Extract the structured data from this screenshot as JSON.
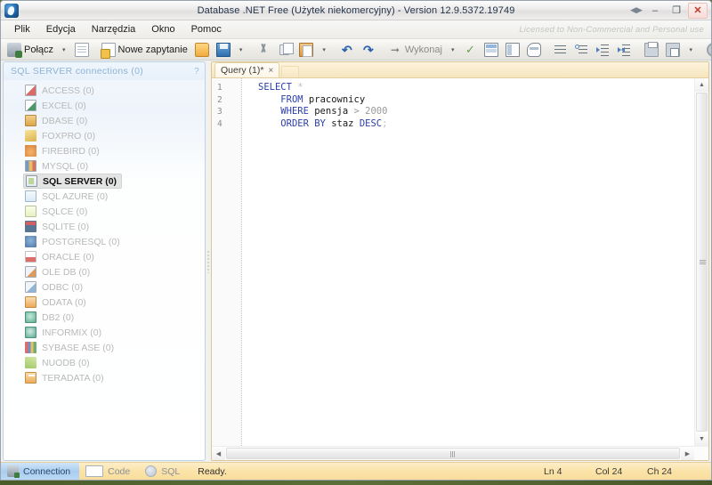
{
  "window": {
    "title": "Database .NET Free (Użytek niekomercyjny) - Version 12.9.5372.19749",
    "logo_icon": "app-logo-icon",
    "controls": {
      "restore_arrows": "◀▶",
      "minimize": "–",
      "maximize": "❐",
      "close": "✕"
    }
  },
  "menubar": {
    "items": [
      {
        "label": "Plik"
      },
      {
        "label": "Edycja"
      },
      {
        "label": "Narzędzia"
      },
      {
        "label": "Okno"
      },
      {
        "label": "Pomoc"
      }
    ],
    "license": "Licensed to Non-Commercial and Personal use"
  },
  "toolbar": {
    "connect_label": "Połącz",
    "new_query_label": "Nowe zapytanie",
    "execute_label": "Wykonaj",
    "dropdown_caret": "▾",
    "items": [
      {
        "name": "connect-button",
        "icon": "plug-icon"
      },
      {
        "name": "connect-dropdown",
        "icon": "chevron-down-icon"
      },
      {
        "name": "connection-properties-button",
        "icon": "document-icon"
      },
      {
        "name": "new-query-button",
        "icon": "new-query-icon"
      },
      {
        "name": "open-button",
        "icon": "folder-open-icon"
      },
      {
        "name": "save-button",
        "icon": "save-disk-icon"
      },
      {
        "name": "save-dropdown",
        "icon": "chevron-down-icon"
      },
      {
        "name": "cut-button",
        "icon": "scissors-icon"
      },
      {
        "name": "copy-button",
        "icon": "copy-icon"
      },
      {
        "name": "paste-button",
        "icon": "paste-icon"
      },
      {
        "name": "paste-dropdown",
        "icon": "chevron-down-icon"
      },
      {
        "name": "undo-button",
        "icon": "undo-arrow-icon"
      },
      {
        "name": "redo-button",
        "icon": "redo-arrow-icon"
      },
      {
        "name": "execute-button",
        "icon": "play-arrow-icon"
      },
      {
        "name": "execute-dropdown",
        "icon": "chevron-down-icon"
      },
      {
        "name": "verify-sql-button",
        "icon": "check-mark-icon"
      },
      {
        "name": "results-grid-button",
        "icon": "grid-icon"
      },
      {
        "name": "results-pane-button",
        "icon": "grid-columns-icon"
      },
      {
        "name": "results-message-button",
        "icon": "grid-round-icon"
      },
      {
        "name": "format-lines-button",
        "icon": "lines-icon"
      },
      {
        "name": "format-list-button",
        "icon": "bullet-lines-icon"
      },
      {
        "name": "indent-button",
        "icon": "indent-icon"
      },
      {
        "name": "outdent-button",
        "icon": "outdent-icon"
      },
      {
        "name": "print-button",
        "icon": "printer-icon"
      },
      {
        "name": "print-preview-button",
        "icon": "print-preview-icon"
      },
      {
        "name": "print-preview-dropdown",
        "icon": "chevron-down-icon"
      },
      {
        "name": "options-button",
        "icon": "gear-icon"
      },
      {
        "name": "plugins-button",
        "icon": "plugins-icon"
      },
      {
        "name": "web-button",
        "icon": "globe-icon"
      },
      {
        "name": "web-dropdown",
        "icon": "chevron-down-icon"
      },
      {
        "name": "help-button",
        "icon": "help-question-icon"
      },
      {
        "name": "export-button",
        "icon": "export-icon"
      }
    ],
    "help_glyph": "?"
  },
  "sidebar": {
    "header": "SQL SERVER connections (0)",
    "help_glyph": "?",
    "items": [
      {
        "label": "ACCESS (0)",
        "icon": "access-icon"
      },
      {
        "label": "EXCEL (0)",
        "icon": "excel-icon"
      },
      {
        "label": "DBASE (0)",
        "icon": "dbase-icon"
      },
      {
        "label": "FOXPRO (0)",
        "icon": "foxpro-icon"
      },
      {
        "label": "FIREBIRD (0)",
        "icon": "firebird-icon"
      },
      {
        "label": "MYSQL (0)",
        "icon": "mysql-icon"
      },
      {
        "label": "SQL SERVER (0)",
        "icon": "sqlserver-icon",
        "selected": true
      },
      {
        "label": "SQL AZURE (0)",
        "icon": "sqlazure-icon"
      },
      {
        "label": "SQLCE (0)",
        "icon": "sqlce-icon"
      },
      {
        "label": "SQLITE (0)",
        "icon": "sqlite-icon"
      },
      {
        "label": "POSTGRESQL (0)",
        "icon": "postgresql-icon"
      },
      {
        "label": "ORACLE (0)",
        "icon": "oracle-icon"
      },
      {
        "label": "OLE DB (0)",
        "icon": "oledb-icon"
      },
      {
        "label": "ODBC (0)",
        "icon": "odbc-icon"
      },
      {
        "label": "ODATA (0)",
        "icon": "odata-icon"
      },
      {
        "label": "DB2 (0)",
        "icon": "db2-icon"
      },
      {
        "label": "INFORMIX (0)",
        "icon": "informix-icon"
      },
      {
        "label": "SYBASE ASE (0)",
        "icon": "sybase-icon"
      },
      {
        "label": "NUODB (0)",
        "icon": "nuodb-icon"
      },
      {
        "label": "TERADATA (0)",
        "icon": "teradata-icon"
      }
    ]
  },
  "editor": {
    "tab": {
      "label": "Query (1)*",
      "close_glyph": "×"
    },
    "line_numbers": [
      "1",
      "2",
      "3",
      "4"
    ],
    "lines": [
      {
        "indent": 0,
        "tokens": [
          {
            "t": "SELECT",
            "c": "kw"
          },
          {
            "t": " ",
            "c": "id"
          },
          {
            "t": "*",
            "c": "punc"
          }
        ]
      },
      {
        "indent": 1,
        "tokens": [
          {
            "t": "FROM",
            "c": "kw"
          },
          {
            "t": " ",
            "c": "id"
          },
          {
            "t": "pracownicy",
            "c": "id"
          }
        ]
      },
      {
        "indent": 1,
        "tokens": [
          {
            "t": "WHERE",
            "c": "kw"
          },
          {
            "t": " ",
            "c": "id"
          },
          {
            "t": "pensja",
            "c": "id"
          },
          {
            "t": " ",
            "c": "id"
          },
          {
            "t": ">",
            "c": "op"
          },
          {
            "t": " ",
            "c": "id"
          },
          {
            "t": "2000",
            "c": "num"
          }
        ]
      },
      {
        "indent": 1,
        "tokens": [
          {
            "t": "ORDER BY",
            "c": "kw"
          },
          {
            "t": " ",
            "c": "id"
          },
          {
            "t": "staz",
            "c": "id"
          },
          {
            "t": " ",
            "c": "id"
          },
          {
            "t": "DESC",
            "c": "kw"
          },
          {
            "t": ";",
            "c": "punc"
          }
        ]
      }
    ],
    "scroll": {
      "up_arrow": "▲",
      "down_arrow": "▼",
      "left_arrow": "◀",
      "right_arrow": "▶"
    }
  },
  "statusbar": {
    "tabs": [
      {
        "label": "Connection",
        "icon": "connection-icon",
        "active": true
      },
      {
        "label": "Code",
        "icon": "code-icon",
        "active": false
      },
      {
        "label": "SQL",
        "icon": "sql-icon",
        "active": false
      }
    ],
    "message": "Ready.",
    "line": "Ln 4",
    "column": "Col 24",
    "character": "Ch 24"
  },
  "colors": {
    "accent": "#f8dd9c",
    "selection": "#a9cdf0",
    "keyword": "#2b3ea8",
    "close_red": "#c0392b"
  }
}
